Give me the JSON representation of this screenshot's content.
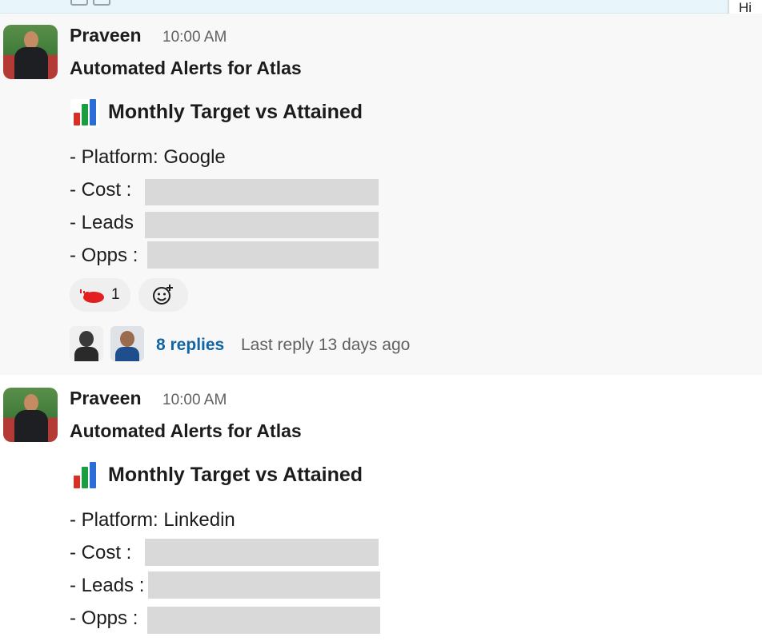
{
  "top_corner": {
    "text": "Hi"
  },
  "messages": [
    {
      "author": "Praveen",
      "time": "10:00 AM",
      "title": "Automated Alerts for Atlas",
      "subtitle": "Monthly Target vs Attained",
      "platform_line": "- Platform: Google",
      "cost_label": "- Cost :",
      "leads_label": "- Leads",
      "opps_label": "- Opps :",
      "reaction": {
        "icon": "red-rocket-emoji",
        "count": "1"
      },
      "add_reaction_icon": "add-emoji-icon",
      "thread": {
        "replies": "8 replies",
        "last_reply": "Last reply 13 days ago"
      }
    },
    {
      "author": "Praveen",
      "time": "10:00 AM",
      "title": "Automated Alerts for Atlas",
      "subtitle": "Monthly Target vs Attained",
      "platform_line": "- Platform: Linkedin",
      "cost_label": "- Cost :",
      "leads_label": "- Leads :",
      "opps_label": "- Opps :"
    }
  ],
  "colors": {
    "link": "#1264a3",
    "muted": "#616061",
    "hover_bg": "#f8f8f8",
    "redaction": "#d9d9d9"
  }
}
